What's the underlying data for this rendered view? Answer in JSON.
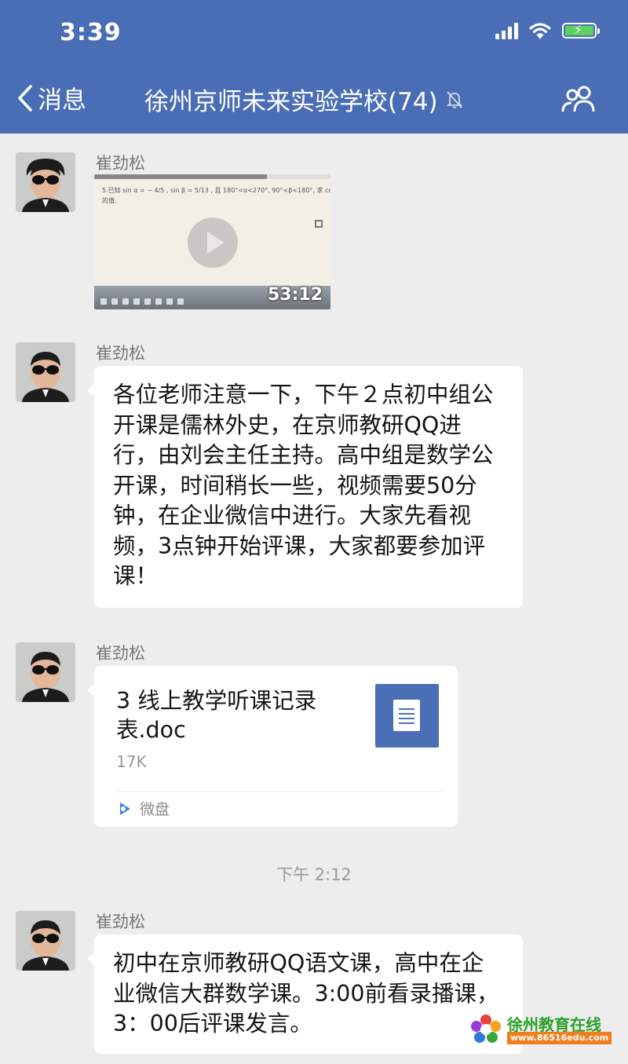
{
  "status_bar": {
    "time": "3:39"
  },
  "nav": {
    "back_label": "消息",
    "title": "徐州京师未来实验学校(74)"
  },
  "messages": [
    {
      "sender": "崔劲松",
      "video": {
        "duration": "53:12"
      }
    },
    {
      "sender": "崔劲松",
      "text": "各位老师注意一下，下午２点初中组公开课是儒林外史，在京师教研QQ进行，由刘会主任主持。高中组是数学公开课，时间稍长一些，视频需要50分钟，在企业微信中进行。大家先看视频，3点钟开始评课，大家都要参加评课！"
    },
    {
      "sender": "崔劲松",
      "file": {
        "name": "3 线上教学听课记录表.doc",
        "size": "17K",
        "source": "微盘"
      }
    },
    {
      "sender": "崔劲松",
      "text": "初中在京师教研QQ语文课，高中在企业微信大群数学课。3:00前看录播课，3：00后评课发言。"
    }
  ],
  "timestamp": "下午 2:12",
  "watermark": {
    "title": "徐州教育在线",
    "url": "www.86516edu.com"
  },
  "colors": {
    "header": "#4a6eb5",
    "background": "#ededed",
    "bubble": "#ffffff",
    "file_icon": "#4b6fb5"
  }
}
